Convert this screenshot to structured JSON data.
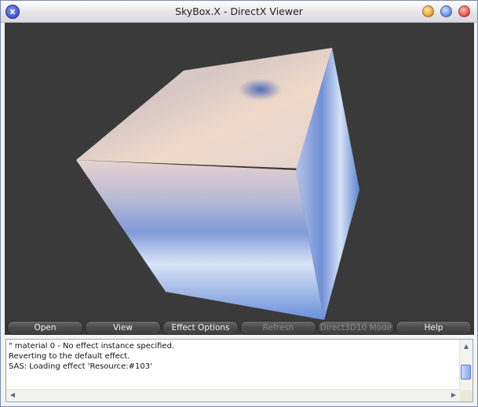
{
  "window": {
    "title": "SkyBox.X - DirectX Viewer",
    "app_icon": "x",
    "controls": [
      "minimize-button",
      "maximize-button",
      "close-button"
    ]
  },
  "viewport": {
    "background_color": "#3a3a3a",
    "cube_colors": {
      "sky_top": "#e6ddd7",
      "sky_blue": "#6f8fd6",
      "sky_deep": "#3f5fb8",
      "glow": "#f2d8c8"
    }
  },
  "toolbar": {
    "buttons": [
      {
        "label": "Open",
        "enabled": true
      },
      {
        "label": "View",
        "enabled": true
      },
      {
        "label": "Effect Options",
        "enabled": true
      },
      {
        "label": "Refresh",
        "enabled": false
      },
      {
        "label": "Direct3D10 Mode",
        "enabled": false
      },
      {
        "label": "Help",
        "enabled": true
      }
    ]
  },
  "console": {
    "lines": [
      "\" material 0 - No effect instance specified.",
      "Reverting to the default effect.",
      "SAS: Loading effect 'Resource:#103'"
    ]
  }
}
